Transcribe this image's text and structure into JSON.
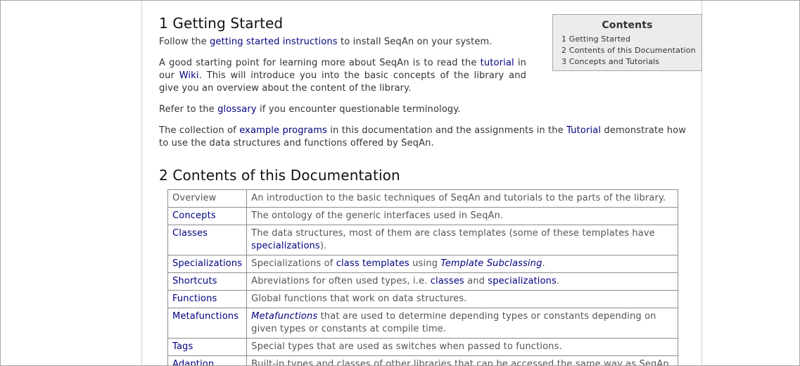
{
  "section1": {
    "heading": "1 Getting Started",
    "p1_pre": "Follow the ",
    "p1_link": "getting started instructions",
    "p1_post": " to install SeqAn on your system.",
    "p2_pre": "A good starting point for learning more about SeqAn is to read the ",
    "p2_link1": "tutorial",
    "p2_mid": " in our ",
    "p2_link2": "Wiki",
    "p2_post": ". This will introduce you into the basic concepts of the library and give you an overview about the content of the library.",
    "p3_pre": "Refer to the ",
    "p3_link": "glossary",
    "p3_post": " if you encounter questionable terminology.",
    "p4_pre": "The collection of ",
    "p4_link1": "example programs",
    "p4_mid": " in this documentation and the assignments in the ",
    "p4_link2": "Tutorial",
    "p4_post": " demonstrate how to use the data structures and functions offered by SeqAn."
  },
  "toc": {
    "title": "Contents",
    "items": [
      "1 Getting Started",
      "2 Contents of this Documentation",
      "3 Concepts and Tutorials"
    ]
  },
  "section2": {
    "heading": "2 Contents of this Documentation",
    "rows": [
      {
        "key": "Overview",
        "desc": "An introduction to the basic techniques of SeqAn and tutorials to the parts of the library."
      },
      {
        "key": "Concepts",
        "desc": "The ontology of the generic interfaces used in SeqAn."
      },
      {
        "key": "Classes",
        "desc_pre": "The data structures, most of them are class templates (some of these templates have ",
        "desc_link": "specializations",
        "desc_post": ")."
      },
      {
        "key": "Specializations",
        "desc_pre": "Specializations of ",
        "desc_link": "class templates",
        "desc_mid": " using ",
        "desc_em": "Template Subclassing",
        "desc_post": "."
      },
      {
        "key": "Shortcuts",
        "desc_pre": "Abreviations for often used types, i.e. ",
        "desc_link1": "classes",
        "desc_mid": " and ",
        "desc_link2": "specializations",
        "desc_post": "."
      },
      {
        "key": "Functions",
        "desc": "Global functions that work on data structures."
      },
      {
        "key": "Metafunctions",
        "desc_em": "Metafunctions",
        "desc_post": " that are used to determine depending types or constants depending on given types or constants at compile time."
      },
      {
        "key": "Tags",
        "desc": "Special types that are used as switches when passed to functions."
      },
      {
        "key": "Adaption",
        "desc": "Built-in types and classes of other libraries that can be accessed the same way as SeqAn"
      }
    ]
  }
}
